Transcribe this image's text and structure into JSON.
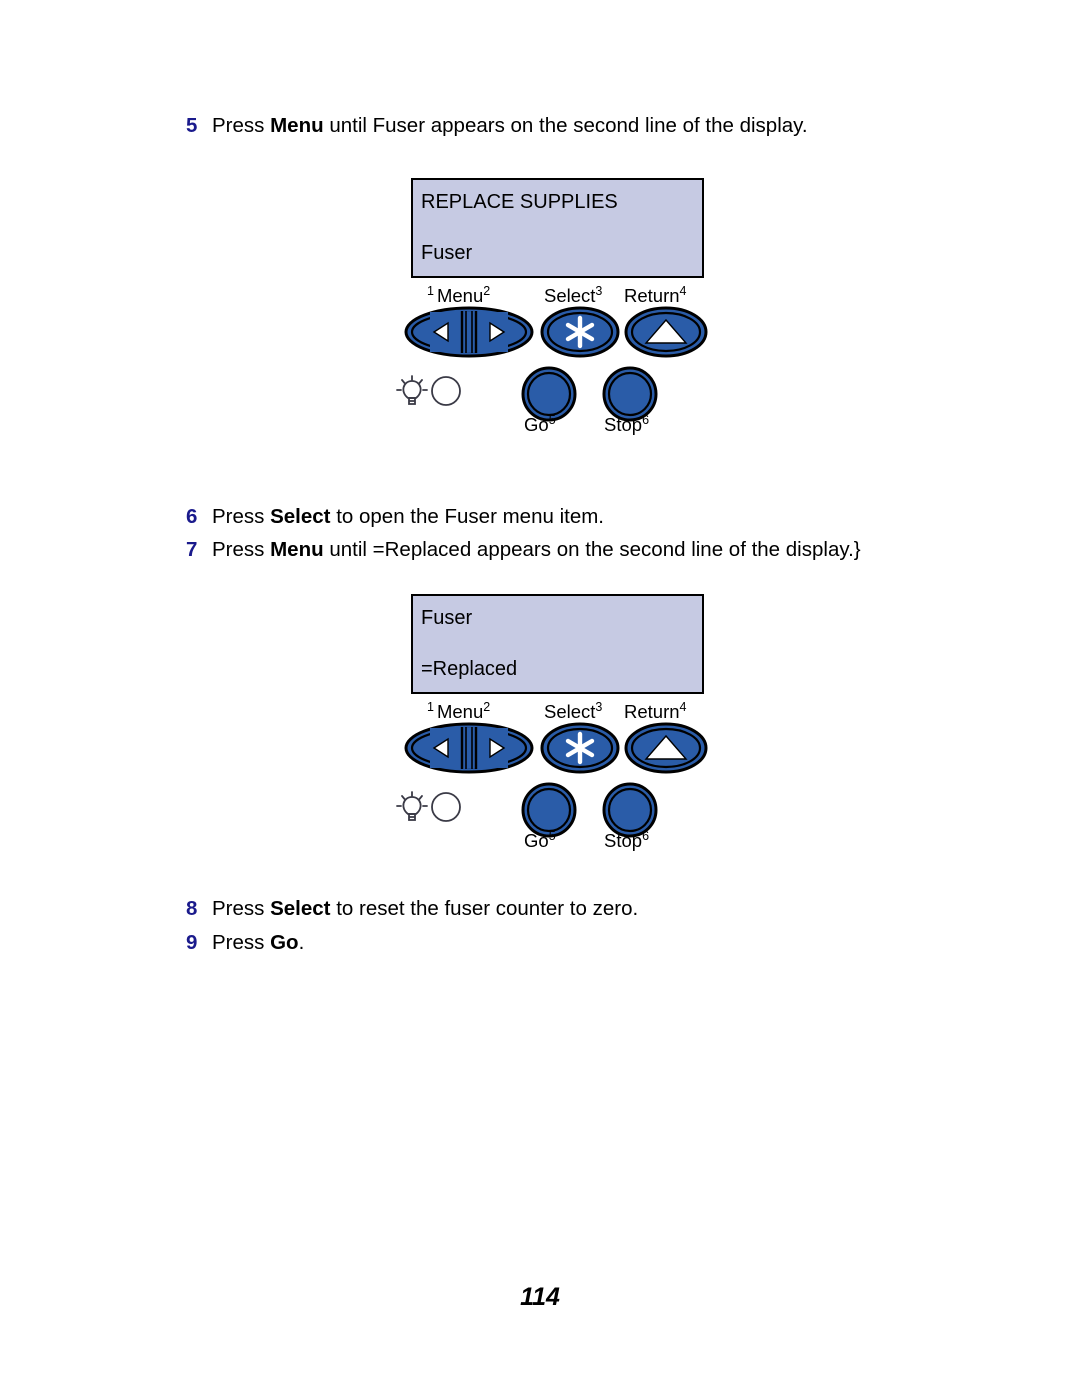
{
  "document": {
    "page_number": "114",
    "accent_color": "#1a1a8c",
    "lcd_background": "#c6cae3",
    "button_color": "#2a5ca8"
  },
  "steps": [
    {
      "number": "5",
      "parts": [
        {
          "text": "Press ",
          "bold": false
        },
        {
          "text": "Menu",
          "bold": true
        },
        {
          "text": " until Fuser  appears on the second line of the display.",
          "bold": false
        }
      ]
    },
    {
      "number": "6",
      "parts": [
        {
          "text": "Press ",
          "bold": false
        },
        {
          "text": "Select",
          "bold": true
        },
        {
          "text": " to open the Fuser  menu item.",
          "bold": false
        }
      ]
    },
    {
      "number": "7",
      "parts": [
        {
          "text": "Press ",
          "bold": false
        },
        {
          "text": "Menu",
          "bold": true
        },
        {
          "text": " until =Replaced   appears on the second line of the display.",
          "bold": false
        }
      ]
    },
    {
      "number": "8",
      "parts": [
        {
          "text": "Press ",
          "bold": false
        },
        {
          "text": "Select",
          "bold": true
        },
        {
          "text": " to reset the fuser counter to zero.",
          "bold": false
        }
      ]
    },
    {
      "number": "9",
      "parts": [
        {
          "text": "Press ",
          "bold": false
        },
        {
          "text": "Go",
          "bold": true
        },
        {
          "text": ".",
          "bold": false
        }
      ]
    }
  ],
  "panels": [
    {
      "display": {
        "line1": "REPLACE SUPPLIES",
        "line2": "Fuser"
      },
      "buttons": {
        "menu": {
          "label": "Menu",
          "number_left": "1",
          "number_right": "2",
          "icon": "menu-scroll-icon"
        },
        "select": {
          "label": "Select",
          "number_right": "3",
          "icon": "asterisk-icon"
        },
        "return": {
          "label": "Return",
          "number_right": "4",
          "icon": "triangle-up-icon"
        },
        "go": {
          "label": "Go",
          "number_right": "5",
          "icon": "round-button-icon"
        },
        "stop": {
          "label": "Stop",
          "number_right": "6",
          "icon": "round-button-icon"
        }
      },
      "indicator": {
        "lamp_icon": "lightbulb-icon",
        "led_icon": "led-circle-icon"
      }
    },
    {
      "display": {
        "line1": "Fuser",
        "line2": "=Replaced"
      },
      "buttons": {
        "menu": {
          "label": "Menu",
          "number_left": "1",
          "number_right": "2",
          "icon": "menu-scroll-icon"
        },
        "select": {
          "label": "Select",
          "number_right": "3",
          "icon": "asterisk-icon"
        },
        "return": {
          "label": "Return",
          "number_right": "4",
          "icon": "triangle-up-icon"
        },
        "go": {
          "label": "Go",
          "number_right": "5",
          "icon": "round-button-icon"
        },
        "stop": {
          "label": "Stop",
          "number_right": "6",
          "icon": "round-button-icon"
        }
      },
      "indicator": {
        "lamp_icon": "lightbulb-icon",
        "led_icon": "led-circle-icon"
      }
    }
  ]
}
